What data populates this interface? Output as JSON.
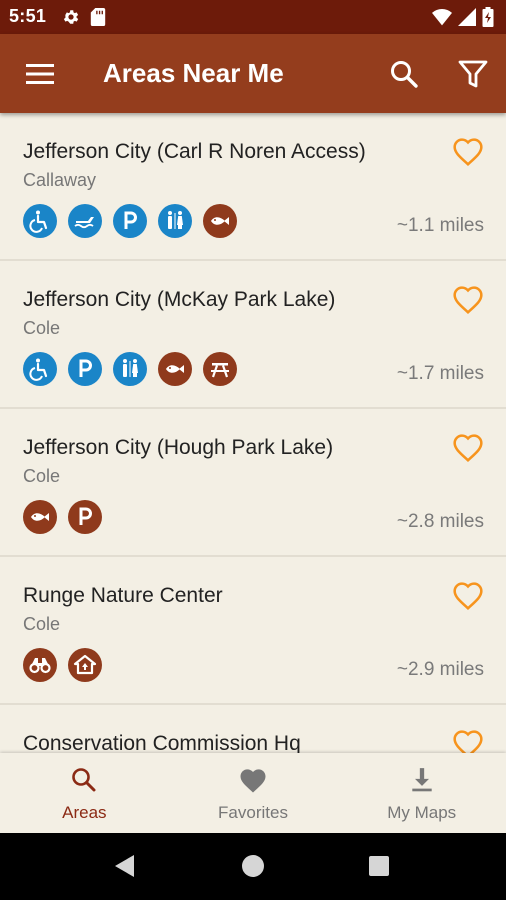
{
  "status_bar": {
    "time": "5:51"
  },
  "app_bar": {
    "title": "Areas Near Me"
  },
  "areas": [
    {
      "name": "Jefferson City (Carl R Noren Access)",
      "county": "Callaway",
      "distance": "~1.1 miles",
      "amenities": [
        "wheelchair-accessible-icon",
        "boat-ramp-icon",
        "parking-icon",
        "restroom-icon",
        "fishing-icon"
      ]
    },
    {
      "name": "Jefferson City (McKay Park Lake)",
      "county": "Cole",
      "distance": "~1.7 miles",
      "amenities": [
        "wheelchair-accessible-icon",
        "parking-icon",
        "restroom-icon",
        "fishing-icon",
        "picnic-table-icon"
      ]
    },
    {
      "name": "Jefferson City (Hough Park Lake)",
      "county": "Cole",
      "distance": "~2.8 miles",
      "amenities": [
        "fishing-icon",
        "parking-icon"
      ]
    },
    {
      "name": "Runge Nature Center",
      "county": "Cole",
      "distance": "~2.9 miles",
      "amenities": [
        "binoculars-icon",
        "nature-center-icon"
      ]
    },
    {
      "name": "Conservation Commission Hq",
      "county": "",
      "distance": "",
      "amenities": []
    }
  ],
  "bottom_nav": {
    "areas": "Areas",
    "favorites": "Favorites",
    "my_maps": "My Maps"
  },
  "colors": {
    "primary_dark": "#6d1b0a",
    "primary": "#943d1d",
    "accent": "#f7941d",
    "amenity_blue": "#1a85c8",
    "amenity_brown": "#8f3a1c",
    "background": "#f3efe4"
  }
}
